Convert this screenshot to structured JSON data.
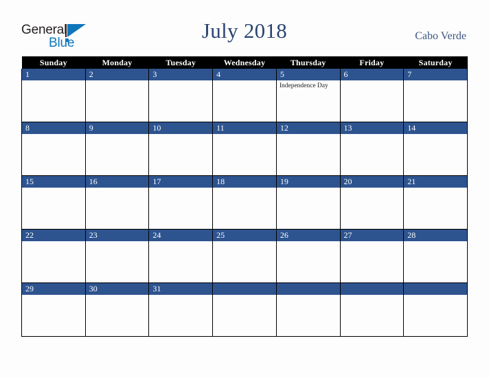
{
  "brand": {
    "name_part1": "General",
    "name_part2": "Blue"
  },
  "header": {
    "title": "July 2018",
    "country": "Cabo Verde"
  },
  "calendar": {
    "weekday_headers": [
      "Sunday",
      "Monday",
      "Tuesday",
      "Wednesday",
      "Thursday",
      "Friday",
      "Saturday"
    ],
    "colors": {
      "day_band": "#2e5490",
      "header_band": "#000000",
      "title": "#2c4470",
      "brand_blue": "#0f76bc"
    },
    "weeks": [
      [
        {
          "day": "1",
          "events": []
        },
        {
          "day": "2",
          "events": []
        },
        {
          "day": "3",
          "events": []
        },
        {
          "day": "4",
          "events": []
        },
        {
          "day": "5",
          "events": [
            "Independence Day"
          ]
        },
        {
          "day": "6",
          "events": []
        },
        {
          "day": "7",
          "events": []
        }
      ],
      [
        {
          "day": "8",
          "events": []
        },
        {
          "day": "9",
          "events": []
        },
        {
          "day": "10",
          "events": []
        },
        {
          "day": "11",
          "events": []
        },
        {
          "day": "12",
          "events": []
        },
        {
          "day": "13",
          "events": []
        },
        {
          "day": "14",
          "events": []
        }
      ],
      [
        {
          "day": "15",
          "events": []
        },
        {
          "day": "16",
          "events": []
        },
        {
          "day": "17",
          "events": []
        },
        {
          "day": "18",
          "events": []
        },
        {
          "day": "19",
          "events": []
        },
        {
          "day": "20",
          "events": []
        },
        {
          "day": "21",
          "events": []
        }
      ],
      [
        {
          "day": "22",
          "events": []
        },
        {
          "day": "23",
          "events": []
        },
        {
          "day": "24",
          "events": []
        },
        {
          "day": "25",
          "events": []
        },
        {
          "day": "26",
          "events": []
        },
        {
          "day": "27",
          "events": []
        },
        {
          "day": "28",
          "events": []
        }
      ],
      [
        {
          "day": "29",
          "events": []
        },
        {
          "day": "30",
          "events": []
        },
        {
          "day": "31",
          "events": []
        },
        {
          "day": "",
          "events": []
        },
        {
          "day": "",
          "events": []
        },
        {
          "day": "",
          "events": []
        },
        {
          "day": "",
          "events": []
        }
      ]
    ]
  }
}
